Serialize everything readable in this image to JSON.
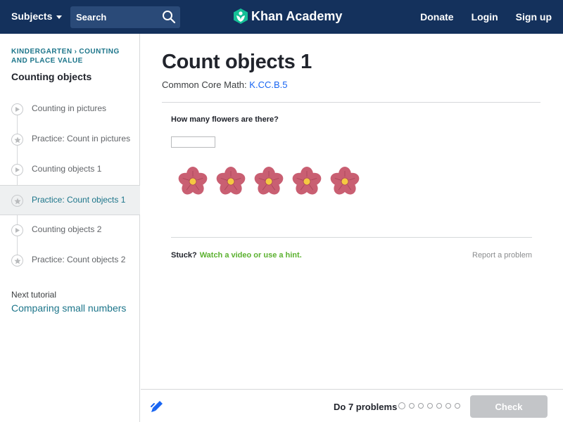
{
  "header": {
    "subjects_label": "Subjects",
    "search_placeholder": "Search",
    "logo_text": "Khan Academy",
    "links": [
      "Donate",
      "Login",
      "Sign up"
    ],
    "background": "#14315c"
  },
  "sidebar": {
    "breadcrumb": [
      "KINDERGARTEN",
      "COUNTING AND PLACE VALUE"
    ],
    "breadcrumb_sep": "›",
    "tutorial_title": "Counting objects",
    "items": [
      {
        "label": "Counting in pictures",
        "icon": "play-icon",
        "active": false
      },
      {
        "label": "Practice: Count in pictures",
        "icon": "star-icon",
        "active": false
      },
      {
        "label": "Counting objects 1",
        "icon": "play-icon",
        "active": false
      },
      {
        "label": "Practice: Count objects 1",
        "icon": "star-icon",
        "active": true
      },
      {
        "label": "Counting objects 2",
        "icon": "play-icon",
        "active": false
      },
      {
        "label": "Practice: Count objects 2",
        "icon": "star-icon",
        "active": false
      }
    ],
    "next_label": "Next tutorial",
    "next_link": "Comparing small numbers"
  },
  "main": {
    "title": "Count objects 1",
    "standard_prefix": "Common Core Math:",
    "standard_code": "K.CC.B.5",
    "question": "How many flowers are there?",
    "answer_value": "",
    "flower_count": 5,
    "stuck_label": "Stuck?",
    "hint_label": "Watch a video or use a hint.",
    "report_label": "Report a problem"
  },
  "footer": {
    "problems_label": "Do 7 problems",
    "problem_count": 7,
    "check_label": "Check"
  },
  "colors": {
    "accent_blue": "#1865f2",
    "teal": "#1c758a",
    "hint_green": "#5bb12f",
    "flower_petal": "#c95f72",
    "flower_center": "#f5c842",
    "check_disabled": "#c3c5c8"
  }
}
